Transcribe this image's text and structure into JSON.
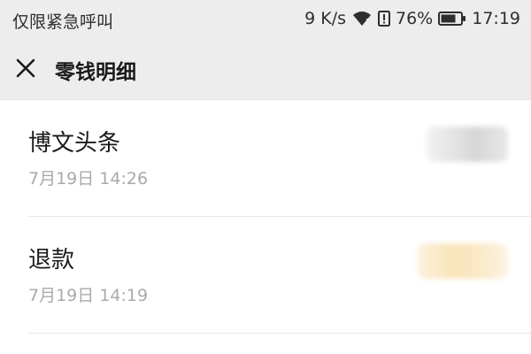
{
  "status_bar": {
    "carrier": "仅限紧急呼叫",
    "network_speed": "9 K/s",
    "battery": "76%",
    "time": "17:19",
    "battery_level": 0.76
  },
  "header": {
    "title": "零钱明细"
  },
  "transactions": [
    {
      "title": "博文头条",
      "time": "7月19日 14:26",
      "amount_style": "gray"
    },
    {
      "title": "退款",
      "time": "7月19日 14:19",
      "amount_style": "yellow"
    }
  ],
  "colors": {
    "bar_background": "#ededed",
    "text_primary": "#1a1a1a",
    "text_secondary": "#aaaaaa"
  }
}
